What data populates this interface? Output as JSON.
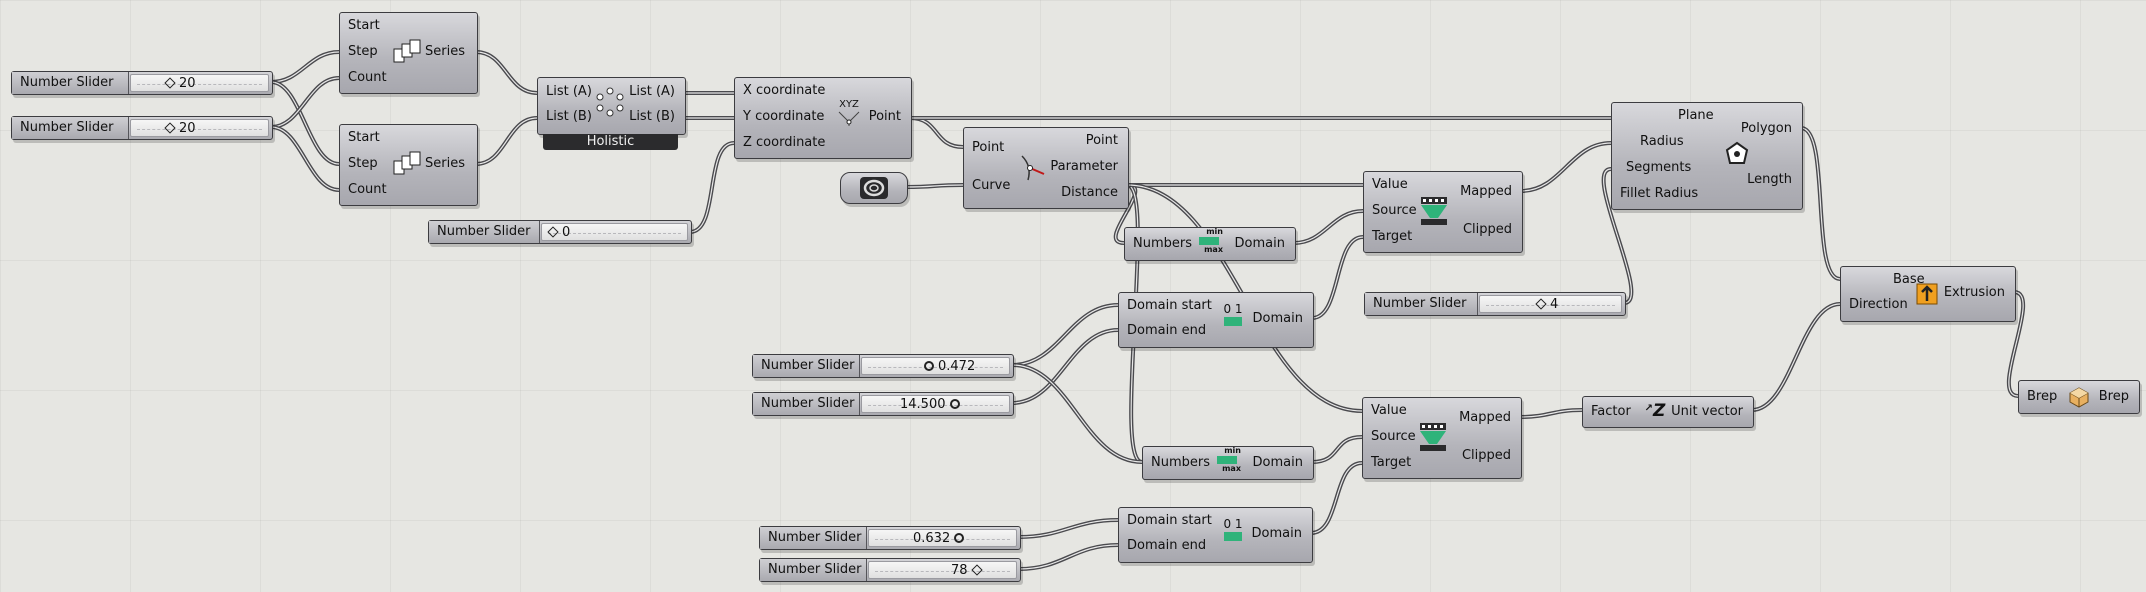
{
  "sliders": [
    {
      "id": "s1",
      "label": "Number Slider",
      "value": "20",
      "knob": "diamond"
    },
    {
      "id": "s2",
      "label": "Number Slider",
      "value": "20",
      "knob": "diamond"
    },
    {
      "id": "s3",
      "label": "Number Slider",
      "value": "0",
      "knob": "diamond"
    },
    {
      "id": "s4",
      "label": "Number Slider",
      "value": "0.472",
      "knob": "circle"
    },
    {
      "id": "s5",
      "label": "Number Slider",
      "value": "14.500",
      "knob": "circle"
    },
    {
      "id": "s6",
      "label": "Number Slider",
      "value": "4",
      "knob": "diamond"
    },
    {
      "id": "s7",
      "label": "Number Slider",
      "value": "0.632",
      "knob": "circle"
    },
    {
      "id": "s8",
      "label": "Number Slider",
      "value": "78",
      "knob": "diamond"
    }
  ],
  "series": {
    "inputs": [
      "Start",
      "Step",
      "Count"
    ],
    "output": "Series"
  },
  "crossref": {
    "inputs": [
      "List (A)",
      "List (B)"
    ],
    "outputs": [
      "List (A)",
      "List (B)"
    ],
    "mode": "Holistic"
  },
  "construct_point": {
    "inputs": [
      "X coordinate",
      "Y coordinate",
      "Z coordinate"
    ],
    "output": "Point",
    "icon_text": "XYZ"
  },
  "curve_cp": {
    "inputs": [
      "Point",
      "Curve"
    ],
    "outputs": [
      "Point",
      "Parameter",
      "Distance"
    ]
  },
  "bounds": {
    "input": "Numbers",
    "output": "Domain",
    "icon_top": "min",
    "icon_bottom": "max"
  },
  "construct_domain": {
    "inputs": [
      "Domain start",
      "Domain end"
    ],
    "output": "Domain",
    "icon_text": "0 1"
  },
  "remap": {
    "inputs": [
      "Value",
      "Source",
      "Target"
    ],
    "outputs": [
      "Mapped",
      "Clipped"
    ]
  },
  "polygon": {
    "inputs": [
      "Plane",
      "Radius",
      "Segments",
      "Fillet Radius"
    ],
    "outputs": [
      "Polygon",
      "Length"
    ]
  },
  "unit_z": {
    "input": "Factor",
    "output": "Unit vector",
    "icon_text": "Z"
  },
  "extrude": {
    "inputs": [
      "Base",
      "Direction"
    ],
    "output": "Extrusion"
  },
  "brep": {
    "input": "Brep",
    "output": "Brep"
  },
  "colors": {
    "canvas": "#e6e6e2",
    "node": "#b4b4ba",
    "wire": "#4a4a4e",
    "holistic": "#2b2b2d",
    "remap_icon": "#2fb37a"
  }
}
